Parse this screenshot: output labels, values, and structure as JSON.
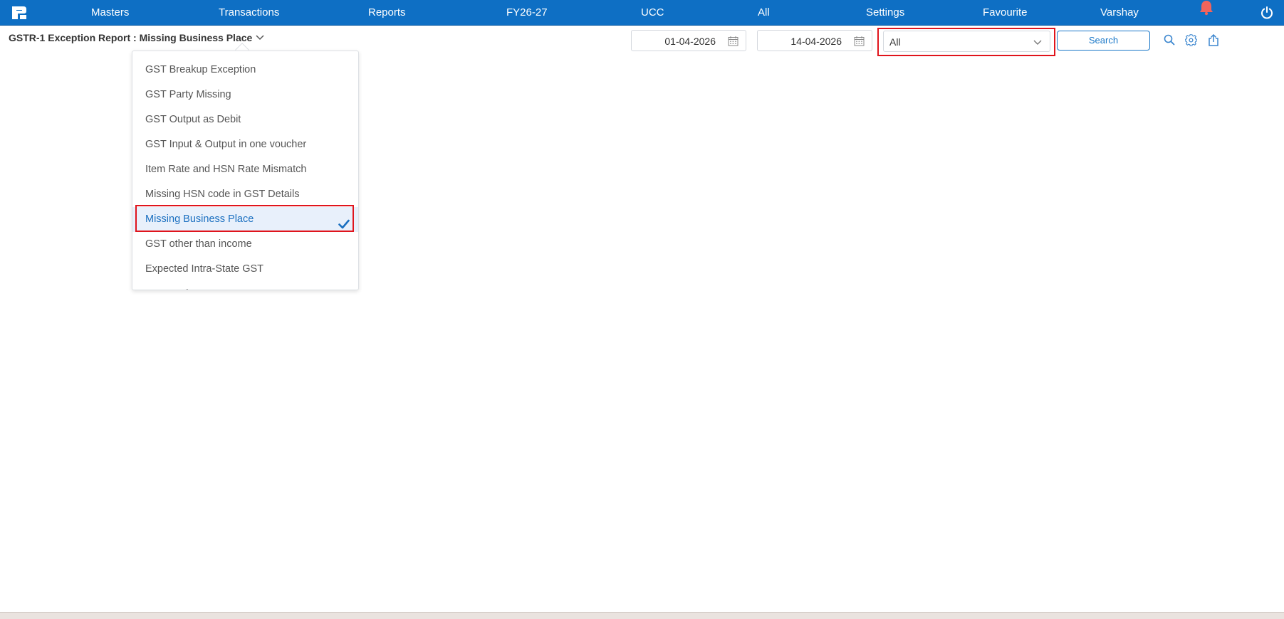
{
  "nav": {
    "items": [
      {
        "label": "Masters"
      },
      {
        "label": "Transactions"
      },
      {
        "label": "Reports"
      },
      {
        "label": "FY26-27"
      },
      {
        "label": "UCC"
      },
      {
        "label": "All"
      },
      {
        "label": "Settings"
      },
      {
        "label": "Favourite"
      },
      {
        "label": "Varshay"
      }
    ],
    "icons": [
      "logo-icon",
      "notification-bell-icon",
      "power-icon"
    ]
  },
  "toolbar": {
    "title": "GSTR-1 Exception Report : Missing Business Place",
    "from_date": "01-04-2026",
    "to_date": "14-04-2026",
    "filter_value": "All",
    "search_label": "Search",
    "icons": [
      "search-icon",
      "settings-gear-icon",
      "export-share-icon"
    ]
  },
  "dropdown": {
    "items": [
      {
        "label": "GST Breakup Exception",
        "selected": false
      },
      {
        "label": "GST Party Missing",
        "selected": false
      },
      {
        "label": "GST Output as Debit",
        "selected": false
      },
      {
        "label": "GST Input & Output in one voucher",
        "selected": false
      },
      {
        "label": "Item Rate and HSN Rate Mismatch",
        "selected": false
      },
      {
        "label": "Missing HSN code in GST Details",
        "selected": false
      },
      {
        "label": "Missing Business Place",
        "selected": true
      },
      {
        "label": "GST other than income",
        "selected": false
      },
      {
        "label": "Expected Intra-State GST",
        "selected": false
      },
      {
        "label": "Expected Inter-State GST",
        "selected": false
      }
    ]
  },
  "colors": {
    "nav_bg": "#0e6fc4",
    "accent": "#1a78c8",
    "highlight_outline": "#e0141c",
    "selected_bg": "#e8f0fb",
    "bell": "#f2645c"
  }
}
